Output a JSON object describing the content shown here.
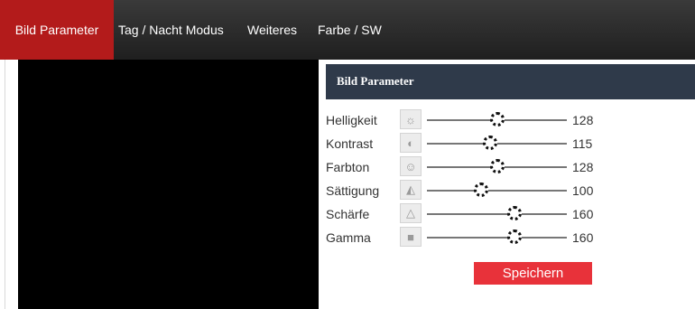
{
  "nav": {
    "tabs": [
      {
        "label": "Bild Parameter",
        "active": true
      },
      {
        "label": "Tag / Nacht Modus"
      },
      {
        "label": "Weiteres"
      },
      {
        "label": "Farbe / SW"
      }
    ]
  },
  "panel": {
    "title": "Bild Parameter",
    "rows": [
      {
        "label": "Helligkeit",
        "icon": "brightness-icon",
        "value": "128",
        "level": 0.5
      },
      {
        "label": "Kontrast",
        "icon": "contrast-icon",
        "value": "115",
        "level": 0.45
      },
      {
        "label": "Farbton",
        "icon": "hue-icon",
        "value": "128",
        "level": 0.5
      },
      {
        "label": "Sättigung",
        "icon": "saturation-icon",
        "value": "100",
        "level": 0.39
      },
      {
        "label": "Schärfe",
        "icon": "sharpness-icon",
        "value": "160",
        "level": 0.627
      },
      {
        "label": "Gamma",
        "icon": "gamma-icon",
        "value": "160",
        "level": 0.627
      }
    ],
    "save_label": "Speichern"
  },
  "colors": {
    "active_tab": "#b31b1b",
    "topbar": "#2a2a2a",
    "panel_header": "#2f3a4a",
    "save_button": "#e8323a"
  }
}
